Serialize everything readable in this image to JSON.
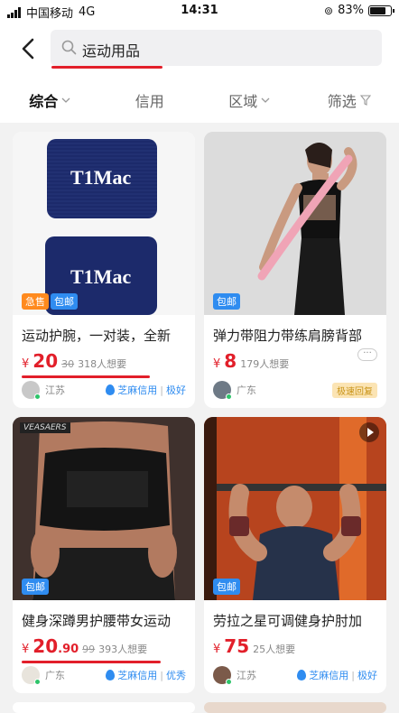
{
  "status_bar": {
    "carrier": "中国移动",
    "network": "4G",
    "time": "14:31",
    "battery": "83%",
    "battery_level": 0.83
  },
  "search": {
    "query": "运动用品"
  },
  "filters": [
    {
      "label": "综合",
      "active": true,
      "icon": "chevron-down-icon"
    },
    {
      "label": "信用",
      "active": false,
      "icon": ""
    },
    {
      "label": "区域",
      "active": false,
      "icon": "chevron-down-icon"
    },
    {
      "label": "筛选",
      "active": false,
      "icon": "filter-icon"
    }
  ],
  "listings": [
    {
      "title": "运动护腕，一对装，全新",
      "tags": [
        "急售",
        "包邮"
      ],
      "currency": "¥",
      "price": "20",
      "price_decimal": "",
      "old_price": "30",
      "wants": "318人想要",
      "location": "江苏",
      "credit": "芝麻信用",
      "credit_level": "极好",
      "image": "navy-wristbands"
    },
    {
      "title": "弹力带阻力带练肩膀背部",
      "tags": [
        "包邮"
      ],
      "currency": "¥",
      "price": "8",
      "price_decimal": "",
      "old_price": "",
      "wants": "179人想要",
      "location": "广东",
      "badge": "极速回复",
      "image": "woman-resistance-band"
    },
    {
      "title": "健身深蹲男护腰带女运动",
      "tags": [
        "包邮"
      ],
      "currency": "¥",
      "price": "20",
      "price_decimal": ".90",
      "old_price": "99",
      "wants": "393人想要",
      "location": "广东",
      "credit": "芝麻信用",
      "credit_level": "优秀",
      "image": "waist-belt",
      "image_text": "VEASAERS"
    },
    {
      "title": "劳拉之星可调健身护肘加",
      "tags": [
        "包邮"
      ],
      "currency": "¥",
      "price": "75",
      "price_decimal": "",
      "old_price": "",
      "wants": "25人想要",
      "location": "江苏",
      "credit": "芝麻信用",
      "credit_level": "极好",
      "image": "man-elbow-sleeves"
    }
  ],
  "wristband_text": [
    "T1Mac",
    "T1Mac"
  ]
}
